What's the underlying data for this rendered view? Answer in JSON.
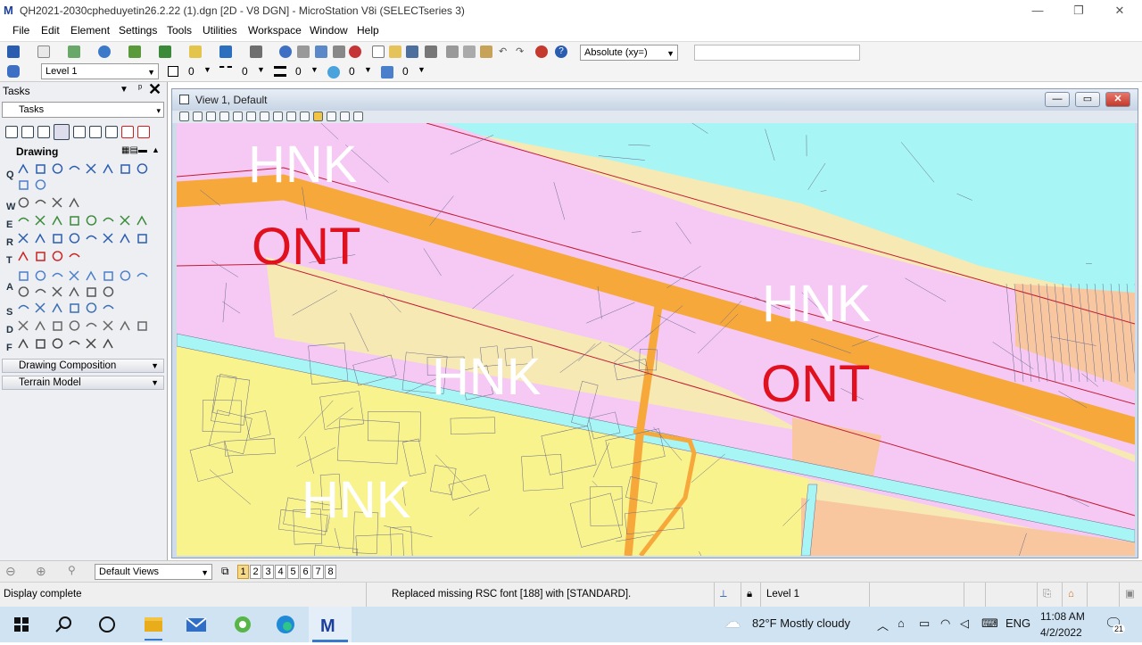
{
  "window": {
    "title": "QH2021-2030cpheduyetin26.2.22 (1).dgn [2D - V8 DGN] - MicroStation V8i (SELECTseries 3)",
    "app_icon": "microstation-icon",
    "minimize": "—",
    "restore": "❐",
    "close": "✕"
  },
  "menu": {
    "items": [
      {
        "label": "File"
      },
      {
        "label": "Edit"
      },
      {
        "label": "Element"
      },
      {
        "label": "Settings"
      },
      {
        "label": "Tools"
      },
      {
        "label": "Utilities"
      },
      {
        "label": "Workspace"
      },
      {
        "label": "Window"
      },
      {
        "label": "Help"
      }
    ]
  },
  "toolbar": {
    "coord_mode": "Absolute (xy=)",
    "key_in": ""
  },
  "attributes": {
    "level": "Level 1",
    "color": "0",
    "style": "0",
    "weight": "0",
    "transparency": "0",
    "priority": "0"
  },
  "tasks": {
    "title": "Tasks",
    "combo": "Tasks",
    "drawing_title": "Drawing",
    "row_letters": [
      "Q",
      "W",
      "E",
      "R",
      "T",
      "A",
      "S",
      "D",
      "F"
    ],
    "sections": [
      "Drawing Composition",
      "Terrain Model"
    ]
  },
  "view": {
    "title": "View 1, Default",
    "map": {
      "colors": {
        "ont": "#f5c9f4",
        "hnk": "#f6e9b4",
        "residential": "#f8f38d",
        "water": "#a7f5f5",
        "road": "#f6a83b",
        "parcel_line": "#6a6a8a",
        "boundary_line": "#c41a33",
        "orange_zone": "#f8c7a0",
        "label_white": "#ffffff",
        "label_red": "#e0101e"
      },
      "labels": [
        {
          "text": "HNK",
          "kind": "white"
        },
        {
          "text": "ONT",
          "kind": "red"
        },
        {
          "text": "HNK",
          "kind": "white"
        },
        {
          "text": "ONT",
          "kind": "red"
        },
        {
          "text": "HNK",
          "kind": "white"
        },
        {
          "text": "HNK",
          "kind": "white"
        }
      ]
    }
  },
  "views_bar": {
    "saved_views": "Default Views",
    "numbers": [
      "1",
      "2",
      "3",
      "4",
      "5",
      "6",
      "7",
      "8"
    ],
    "active": "1"
  },
  "status": {
    "message": "Display complete",
    "prompt": "Replaced missing RSC font [188] with [STANDARD].",
    "level": "Level 1"
  },
  "taskbar": {
    "weather": "82°F  Mostly cloudy",
    "lang": "ENG",
    "time": "11:08 AM",
    "date": "4/2/2022",
    "notifications": "21"
  }
}
